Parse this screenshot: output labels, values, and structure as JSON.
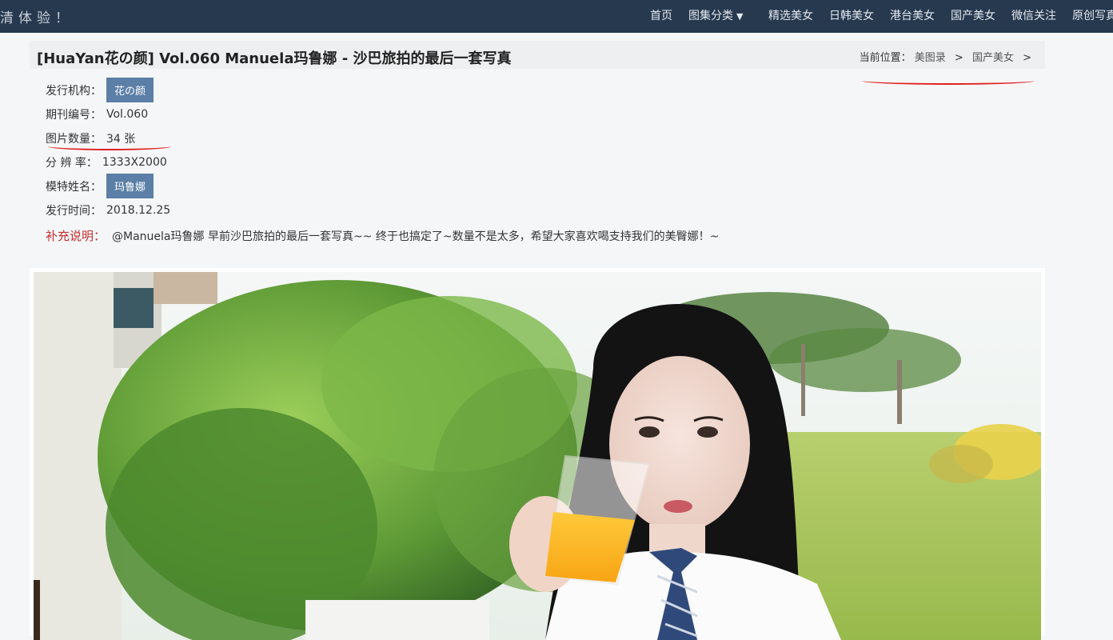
{
  "header": {
    "brand": "清体验！",
    "nav": [
      {
        "label": "首页"
      },
      {
        "label": "图集分类",
        "has_dropdown": true
      },
      {
        "label": "精选美女"
      },
      {
        "label": "日韩美女"
      },
      {
        "label": "港台美女"
      },
      {
        "label": "国产美女"
      },
      {
        "label": "微信关注"
      },
      {
        "label": "原创写真"
      }
    ]
  },
  "article": {
    "title": "[HuaYan花の颜] Vol.060 Manuela玛鲁娜 - 沙巴旅拍的最后一套写真",
    "breadcrumb": {
      "label": "当前位置：",
      "items": [
        "美图录",
        "国产美女"
      ],
      "separator": ">"
    },
    "meta": {
      "publisher_label": "发行机构：",
      "publisher": "花の颜",
      "issue_label": "期刊编号：",
      "issue": "Vol.060",
      "count_label": "图片数量：",
      "count": "34 张",
      "resolution_label": "分 辨 率：",
      "resolution": "1333X2000",
      "model_label": "模特姓名：",
      "model": "玛鲁娜",
      "date_label": "发行时间：",
      "date": "2018.12.25",
      "note_label": "补充说明：",
      "note": "@Manuela玛鲁娜 早前沙巴旅拍的最后一套写真~~ 终于也搞定了~数量不是太多，希望大家喜欢喝支持我们的美臀娜！~"
    }
  },
  "colors": {
    "topbar": "#27394f",
    "tag": "#5b7fa6",
    "note_label": "#c62f2f",
    "annotation": "#e02020"
  }
}
